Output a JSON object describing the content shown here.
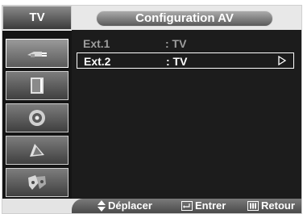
{
  "side_panel": {
    "header": "TV",
    "items": [
      {
        "icon": "antenna-plug-icon"
      },
      {
        "icon": "picture-icon"
      },
      {
        "icon": "speaker-icon"
      },
      {
        "icon": "channel-satellite-icon"
      },
      {
        "icon": "setup-gears-icon"
      }
    ]
  },
  "menu": {
    "title": "Configuration AV",
    "rows": [
      {
        "label": "Ext.1",
        "value": ": TV",
        "selected": false
      },
      {
        "label": "Ext.2",
        "value": ": TV",
        "selected": true
      }
    ]
  },
  "help": {
    "move": "Déplacer",
    "enter": "Entrer",
    "return": "Retour"
  }
}
